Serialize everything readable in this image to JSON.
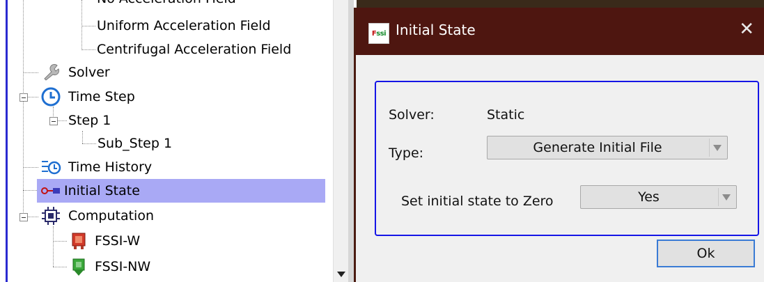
{
  "tree": {
    "items": [
      {
        "label": "No Acceleration Field",
        "icon": "none"
      },
      {
        "label": "Uniform Acceleration Field",
        "icon": "none"
      },
      {
        "label": "Centrifugal Acceleration Field",
        "icon": "none"
      },
      {
        "label": "Solver",
        "icon": "wrench-icon"
      },
      {
        "label": "Time Step",
        "icon": "clock-icon"
      },
      {
        "label": "Step 1",
        "icon": "none"
      },
      {
        "label": "Sub_Step 1",
        "icon": "none"
      },
      {
        "label": "Time History",
        "icon": "time-history-icon"
      },
      {
        "label": "Initial State",
        "icon": "initial-state-icon",
        "selected": true
      },
      {
        "label": "Computation",
        "icon": "chip-icon"
      },
      {
        "label": "FSSI-W",
        "icon": "fssi-w-icon"
      },
      {
        "label": "FSSI-NW",
        "icon": "fssi-nw-icon"
      }
    ]
  },
  "dialog": {
    "title": "Initial State",
    "app_icon": {
      "part1": "F",
      "part2": "ssi"
    },
    "close_glyph": "✕",
    "solver_label": "Solver:",
    "solver_value": "Static",
    "type_label": "Type:",
    "type_value": "Generate Initial File",
    "zero_label": "Set initial state to Zero",
    "zero_value": "Yes",
    "ok_label": "Ok"
  },
  "colors": {
    "titlebar": "#4e1610",
    "selection": "#a9a9f5",
    "group_border": "#1515e6",
    "tree_border": "#2b2bd0"
  }
}
